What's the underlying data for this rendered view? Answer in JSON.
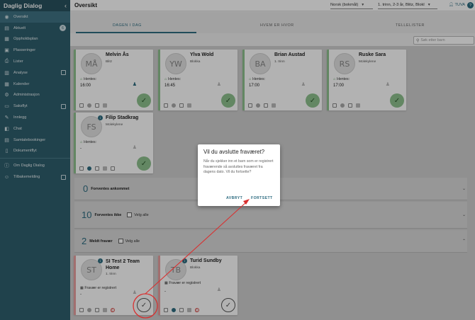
{
  "sidebar": {
    "title": "Daglig Dialog",
    "items": [
      {
        "label": "Oversikt",
        "icon": "eye-icon"
      },
      {
        "label": "Aktuelt",
        "icon": "news-icon",
        "badge": "6"
      },
      {
        "label": "Oppholdsplan",
        "icon": "calendar-icon"
      },
      {
        "label": "Plasseringer",
        "icon": "person-card-icon"
      },
      {
        "label": "Lister",
        "icon": "printer-icon"
      },
      {
        "label": "Analyse",
        "icon": "chart-icon"
      },
      {
        "label": "Kalender",
        "icon": "calendar-grid-icon"
      },
      {
        "label": "Administrasjon",
        "icon": "gear-icon"
      },
      {
        "label": "Saksflyt",
        "icon": "folder-icon"
      },
      {
        "label": "Innlegg",
        "icon": "post-icon"
      },
      {
        "label": "Chat",
        "icon": "chat-icon"
      },
      {
        "label": "Samtalebookinger",
        "icon": "booking-icon"
      },
      {
        "label": "Dokumentflyt",
        "icon": "document-icon"
      },
      {
        "label": "Om Daglig Dialog",
        "icon": "info-icon"
      },
      {
        "label": "Tilbakemelding",
        "icon": "feedback-icon"
      }
    ]
  },
  "header": {
    "page_title": "Oversikt",
    "language": "Norsk (bokmål)",
    "group_filter": "1. trinn, 2-3 år, Blitz, Blokl",
    "user": "TUVA",
    "help": "?"
  },
  "tabs": [
    "DAGEN I DAG",
    "HVEM ER HVOR",
    "TELLELISTER"
  ],
  "search": {
    "placeholder": "Søk etter barn"
  },
  "cards_present": [
    {
      "initials": "MÅ",
      "name": "Melvin Ås",
      "group": "Blitz",
      "pickup_label": "Hentes:",
      "time": "16:00"
    },
    {
      "initials": "YW",
      "name": "Ylva Wold",
      "group": "Blokka",
      "pickup_label": "Hentes:",
      "time": "16:45"
    },
    {
      "initials": "BA",
      "name": "Brian Austad",
      "group": "1. trinn",
      "pickup_label": "Hentes:",
      "time": "17:00"
    },
    {
      "initials": "RS",
      "name": "Ruske Sara",
      "group": "Molekylene",
      "pickup_label": "Hentes:",
      "time": "17:00"
    },
    {
      "initials": "FS",
      "name": "Filip Stadkrag",
      "group": "Molekylene",
      "pickup_label": "Hentes:",
      "time": "-"
    }
  ],
  "sections": {
    "expected": {
      "count": "0",
      "label": "Forventes ankommet"
    },
    "not_expected": {
      "count": "10",
      "label": "Forventes ikke",
      "select_all": "Velg alle"
    },
    "absent": {
      "count": "2",
      "label": "Meldt fravær",
      "select_all": "Velg alle"
    }
  },
  "cards_absent": [
    {
      "initials": "ST",
      "name": "SI Test 2 Team Home",
      "group": "1. trinn",
      "status": "Fravær er registrert",
      "time": "-"
    },
    {
      "initials": "TB",
      "name": "Turid Sundby",
      "group": "Blokka",
      "status": "Fravær er registrert",
      "time": "-"
    }
  ],
  "dialog": {
    "title": "Vil du avslutte fraværet?",
    "body": "Når du sjekker inn et barn som er registrert fraværende så avsluttes fraværet fra dagens dato. Vil du fortsette?",
    "cancel": "AVBRYT",
    "confirm": "FORTSETT"
  },
  "colors": {
    "accent": "#2f6d82",
    "sidebar": "#2f5f6e",
    "present": "#8fc28f",
    "absent": "#e8a0a0",
    "annotation": "#d93030"
  }
}
